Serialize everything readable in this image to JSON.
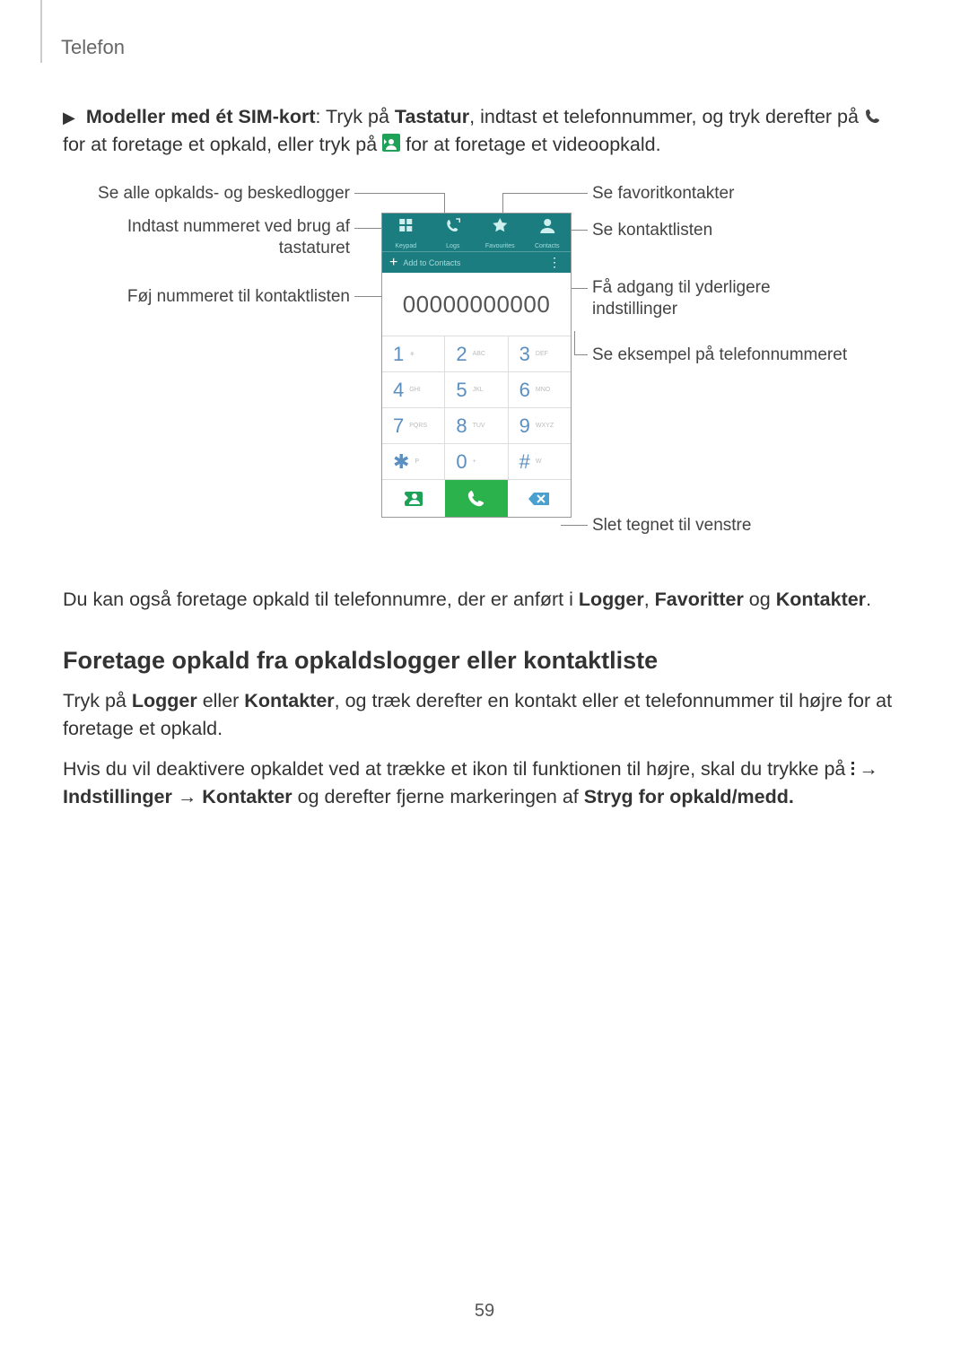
{
  "header": {
    "section": "Telefon"
  },
  "intro": {
    "lead_bold": "Modeller med ét SIM-kort",
    "lead_after": ": Tryk på ",
    "tastatur": "Tastatur",
    "after_tastatur": ", indtast et telefonnummer, og tryk derefter på ",
    "line2a": "for at foretage et opkald, eller tryk på ",
    "line2b": " for at foretage et videoopkald."
  },
  "ann_left": {
    "a1": "Se alle opkalds- og beskedlogger",
    "a2": "Indtast nummeret ved brug af tastaturet",
    "a3": "Føj nummeret til kontaktlisten"
  },
  "ann_right": {
    "b1": "Se favoritkontakter",
    "b2": "Se kontaktlisten",
    "b3": "Få adgang til yderligere indstillinger",
    "b4": "Se eksempel på telefonnummeret",
    "b5": "Slet tegnet til venstre"
  },
  "phone": {
    "tabs": {
      "keypad": "Keypad",
      "logs": "Logs",
      "favourites": "Favourites",
      "contacts": "Contacts"
    },
    "addrow": "Add to Contacts",
    "number": "00000000000",
    "keys": [
      {
        "d": "1",
        "s": "⚘"
      },
      {
        "d": "2",
        "s": "ABC"
      },
      {
        "d": "3",
        "s": "DEF"
      },
      {
        "d": "4",
        "s": "GHI"
      },
      {
        "d": "5",
        "s": "JKL"
      },
      {
        "d": "6",
        "s": "MNO"
      },
      {
        "d": "7",
        "s": "PQRS"
      },
      {
        "d": "8",
        "s": "TUV"
      },
      {
        "d": "9",
        "s": "WXYZ"
      },
      {
        "d": "✱",
        "s": "P"
      },
      {
        "d": "0",
        "s": "+"
      },
      {
        "d": "#",
        "s": "W"
      }
    ]
  },
  "below": {
    "text_a": "Du kan også foretage opkald til telefonnumre, der er anført i ",
    "logger": "Logger",
    "sep1": ", ",
    "favoritter": "Favoritter",
    "sep2": " og ",
    "kontakter": "Kontakter",
    "tail": "."
  },
  "section2": {
    "heading": "Foretage opkald fra opkaldslogger eller kontaktliste",
    "p1a": "Tryk på ",
    "logger": "Logger",
    "p1b": " eller ",
    "kontakter": "Kontakter",
    "p1c": ", og træk derefter en kontakt eller et telefonnummer til højre for at foretage et opkald.",
    "p2a": "Hvis du vil deaktivere opkaldet ved at trække et ikon til funktionen til højre, skal du trykke på ",
    "arrow": "→",
    "indstillinger": "Indstillinger",
    "p2b": " → ",
    "kontakter2": "Kontakter",
    "p2c": " og derefter fjerne markeringen af ",
    "stryg": "Stryg for opkald/medd."
  },
  "pagenum": "59"
}
